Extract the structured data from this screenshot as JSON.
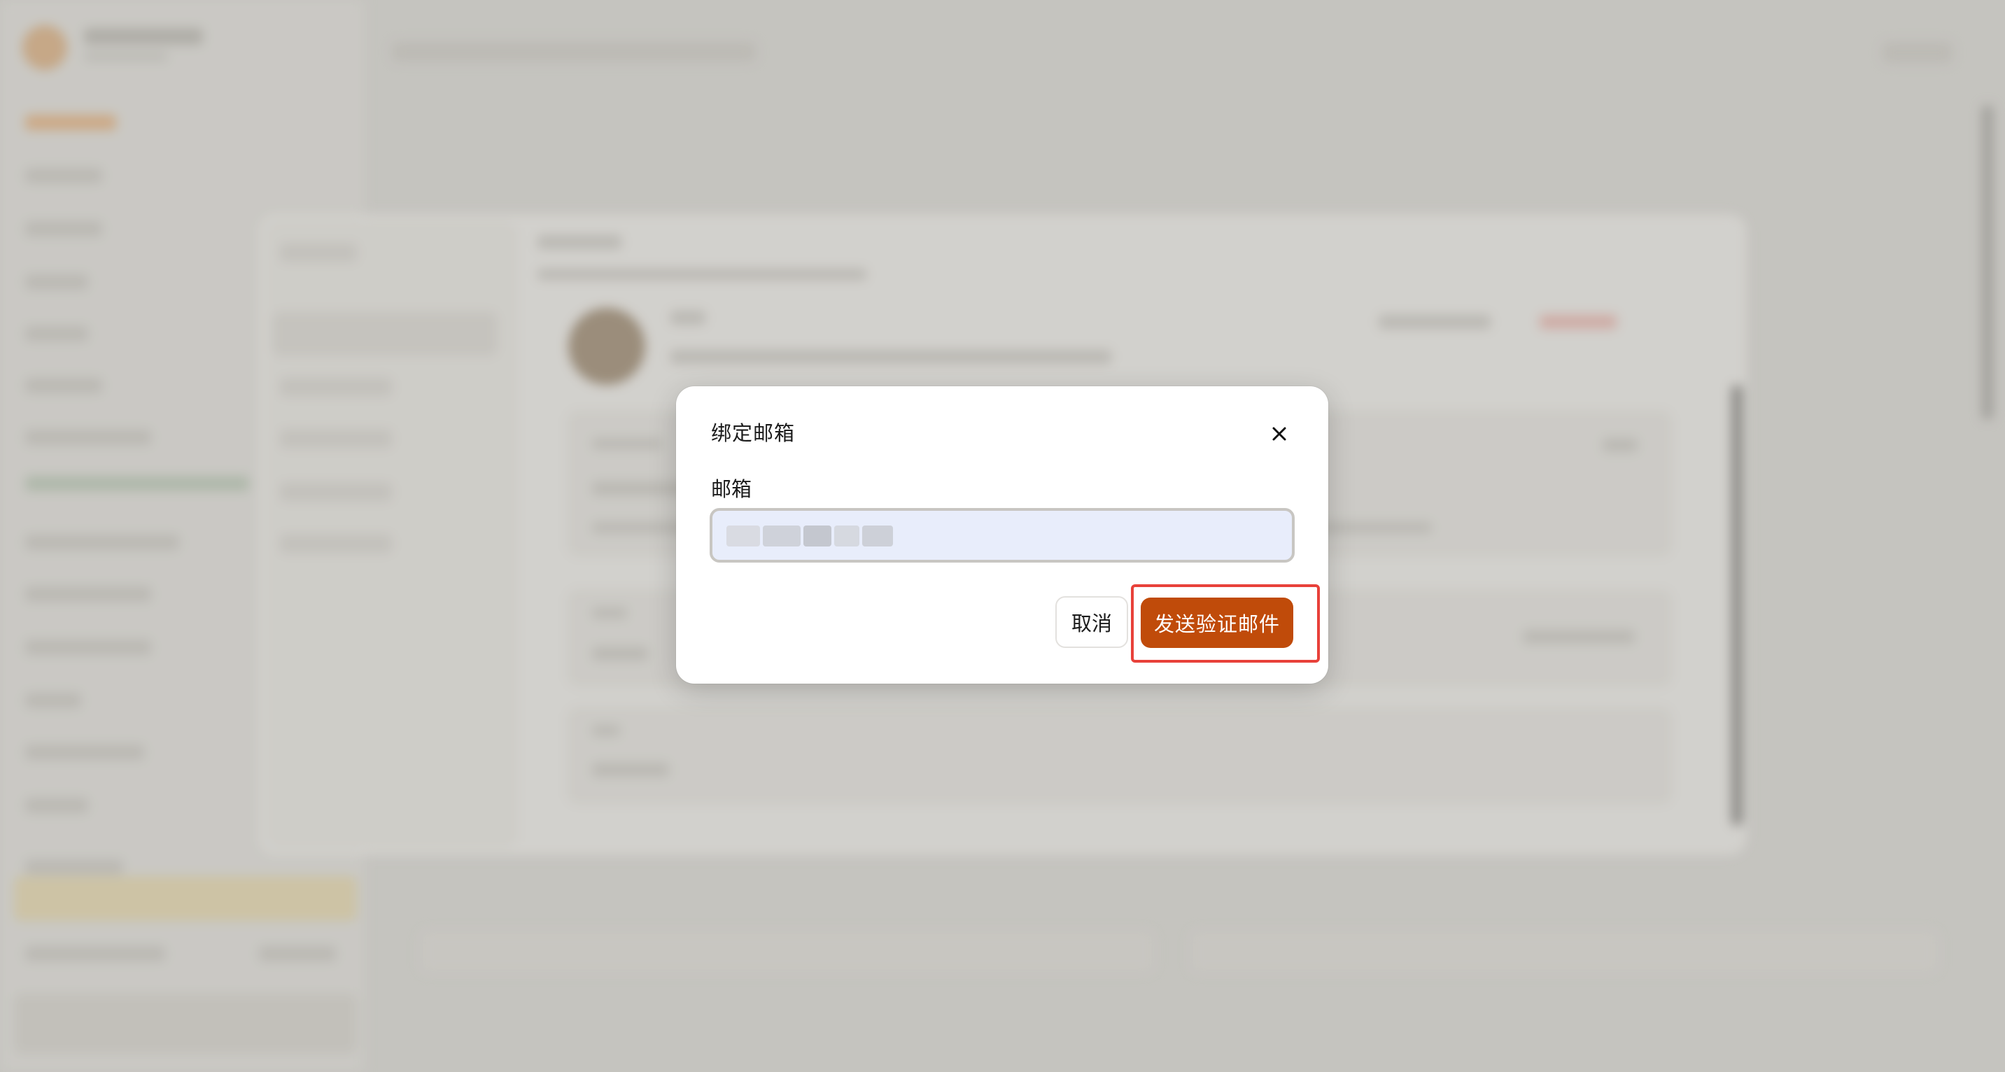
{
  "dialog": {
    "title": "绑定邮箱",
    "close_icon": "close-icon",
    "email_label": "邮箱",
    "email_value": "",
    "cancel_label": "取消",
    "send_label": "发送验证邮件"
  },
  "colors": {
    "primary_button": "#c04b0a",
    "highlight_border": "#e8413a",
    "input_background": "#e8edfb"
  }
}
